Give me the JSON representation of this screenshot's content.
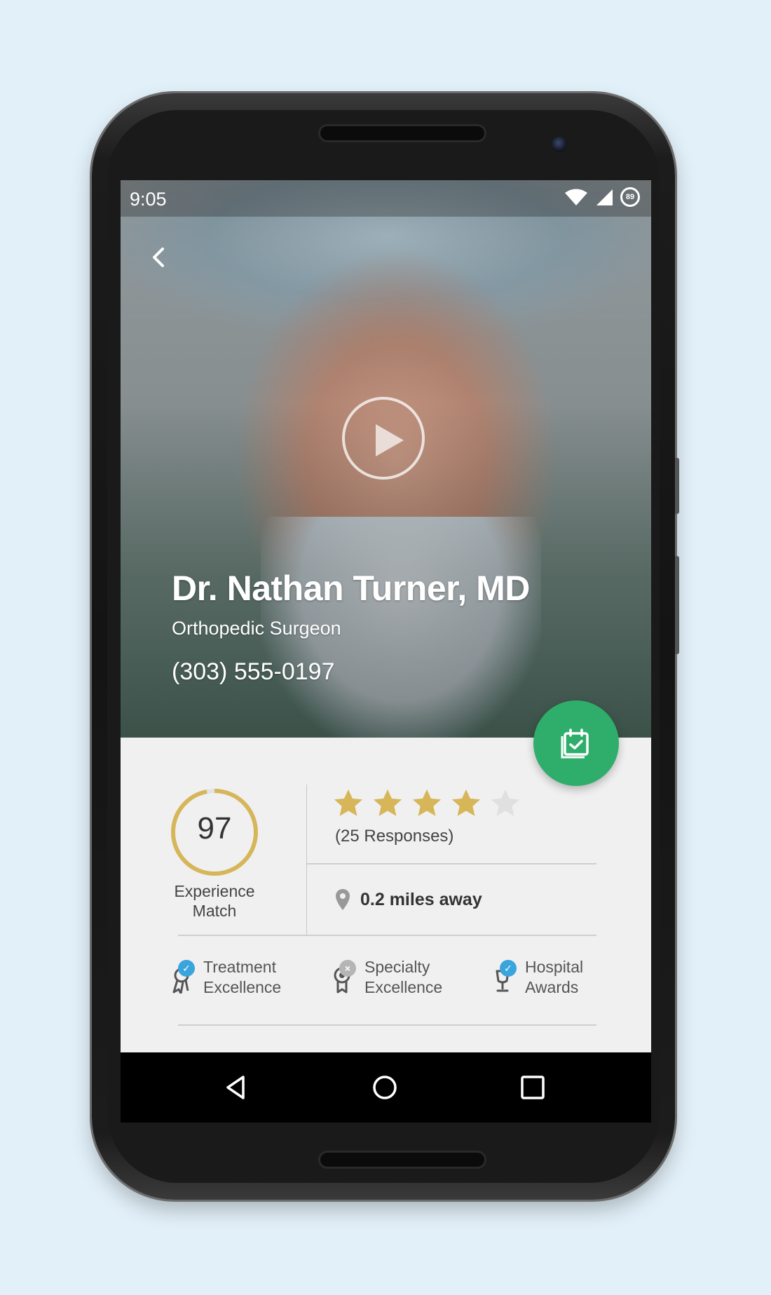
{
  "statusbar": {
    "time": "9:05",
    "battery": "89"
  },
  "doctor": {
    "name": "Dr. Nathan Turner, MD",
    "specialty": "Orthopedic Surgeon",
    "phone": "(303) 555-0197"
  },
  "score": {
    "value": "97",
    "label_line1": "Experience",
    "label_line2": "Match",
    "fraction": 0.97
  },
  "rating": {
    "stars_filled": 4,
    "stars_total": 5,
    "responses": "(25 Responses)"
  },
  "distance": "0.2 miles away",
  "awards": [
    {
      "line1": "Treatment",
      "line2": "Excellence",
      "status": "check",
      "icon": "ribbon-award-icon"
    },
    {
      "line1": "Specialty",
      "line2": "Excellence",
      "status": "x",
      "icon": "medal-award-icon"
    },
    {
      "line1": "Hospital",
      "line2": "Awards",
      "status": "check",
      "icon": "trophy-award-icon"
    }
  ],
  "colors": {
    "fab": "#2fae6b",
    "gold": "#d7b65a",
    "check_badge": "#3aa4dd",
    "x_badge": "#b5b5b5"
  }
}
